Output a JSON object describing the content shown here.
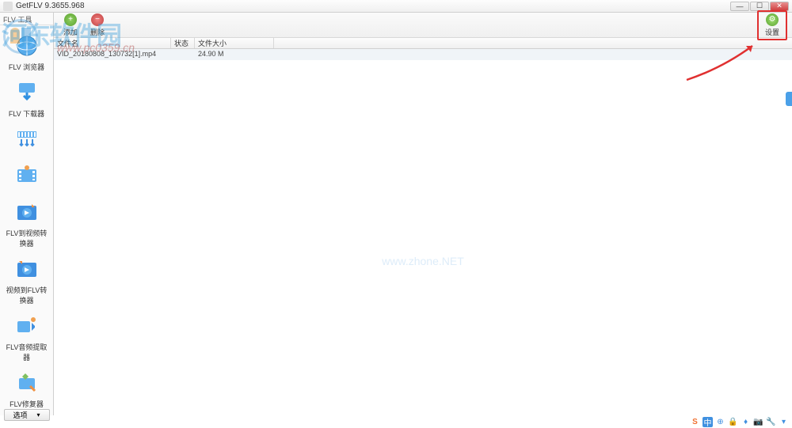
{
  "window": {
    "title": "GetFLV 9.3655.968"
  },
  "sidebar": {
    "header": "FLV 工具",
    "items": [
      {
        "label": "FLV 浏览器",
        "icon": "browser"
      },
      {
        "label": "FLV 下载器",
        "icon": "download"
      },
      {
        "label": "",
        "icon": "splitter"
      },
      {
        "label": "",
        "icon": "film"
      },
      {
        "label": "FLV到视频转换器",
        "icon": "converter1"
      },
      {
        "label": "视频到FLV转换器",
        "icon": "converter2"
      },
      {
        "label": "FLV音频提取器",
        "icon": "audio"
      },
      {
        "label": "FLV修复器",
        "icon": "repair"
      }
    ],
    "footer_btn": "选项"
  },
  "toolbar": {
    "add_label": "添加",
    "del_label": "删除",
    "settings_label": "设置"
  },
  "table": {
    "headers": {
      "filename": "文件名",
      "status": "状态",
      "size": "文件大小"
    },
    "rows": [
      {
        "filename": "VID_20180808_130732[1].mp4",
        "status": "",
        "size": "24.90 M"
      }
    ]
  },
  "watermarks": {
    "logo_text": "河东软件园",
    "url": "www.pc0359.cn",
    "center": "www.zhone.NET"
  },
  "tray": {
    "items": [
      "S",
      "中",
      "⊕",
      "🔒",
      "♦",
      "📷",
      "🔧",
      "▾"
    ]
  }
}
